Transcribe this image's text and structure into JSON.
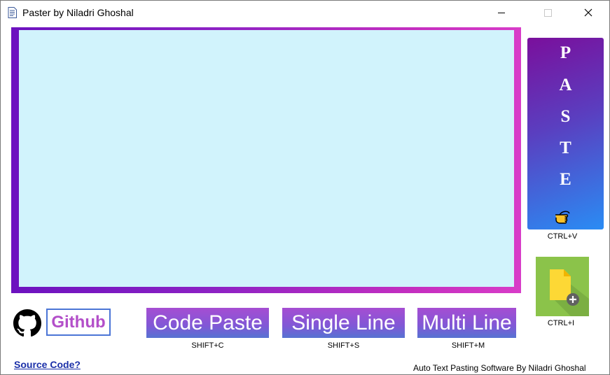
{
  "window": {
    "title": "Paster by Niladri Ghoshal",
    "icon": "document-icon",
    "controls": [
      "minimize-icon",
      "maximize-icon",
      "close-icon"
    ]
  },
  "text_area": {
    "value": ""
  },
  "paste_button": {
    "letters": [
      "P",
      "A",
      "S",
      "T",
      "E"
    ],
    "icon": "pointing-hand-icon",
    "shortcut": "CTRL+V"
  },
  "insert_file_button": {
    "icon": "add-file-icon",
    "shortcut": "CTRL+I"
  },
  "github": {
    "icon": "github-icon",
    "label": "Github"
  },
  "buttons": [
    {
      "label": "Code Paste",
      "shortcut": "SHIFT+C"
    },
    {
      "label": "Single Line",
      "shortcut": "SHIFT+S"
    },
    {
      "label": "Multi Line",
      "shortcut": "SHIFT+M"
    }
  ],
  "source_link": "Source Code?",
  "footer": "Auto Text Pasting Software By Niladri Ghoshal",
  "colors": {
    "text_area_bg": "#d1f3fc",
    "frame_gradient": [
      "#6c12bf",
      "#d83cc8"
    ],
    "paste_gradient": [
      "#7a0f9c",
      "#2a8cf4"
    ],
    "button_gradient": [
      "#a64dd2",
      "#5673d2"
    ],
    "github_text": "#b34fc9",
    "link": "#1a2fa8",
    "file_tile": "#8bc34a"
  }
}
